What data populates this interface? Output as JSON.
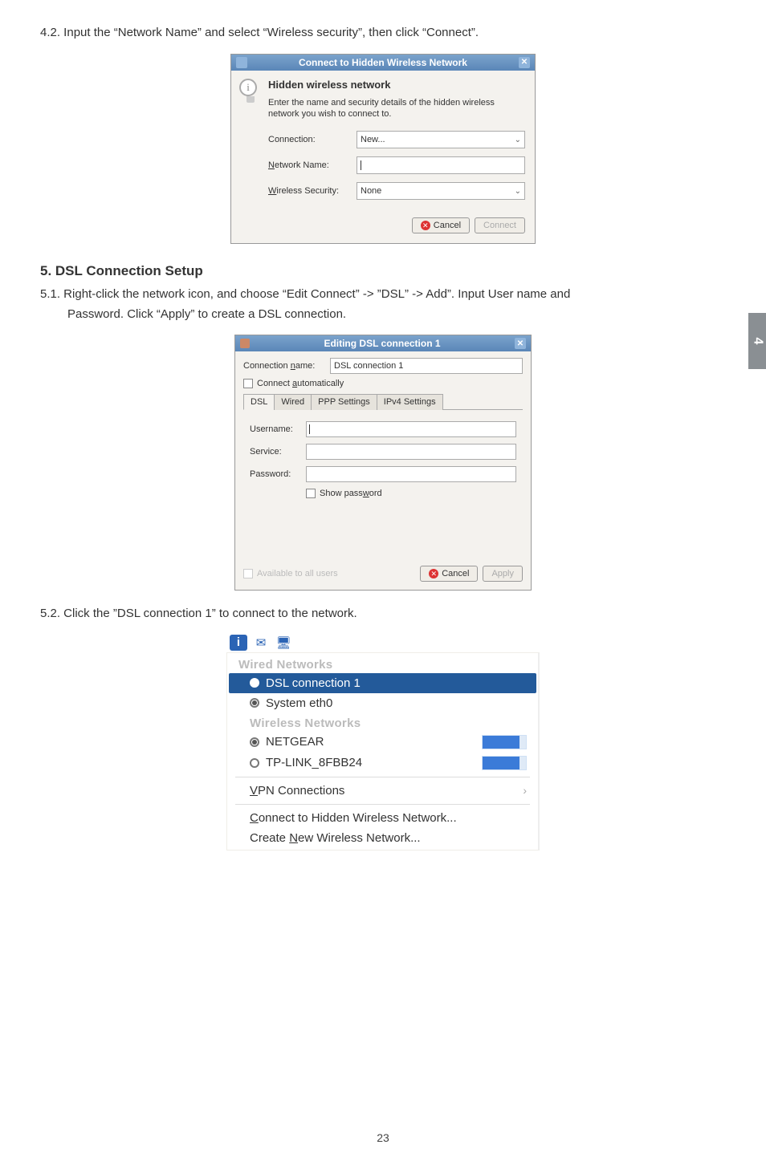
{
  "section42": "4.2. Input the “Network Name” and select “Wireless security”, then click “Connect”.",
  "dialog1": {
    "title": "Connect to Hidden Wireless Network",
    "heading": "Hidden wireless network",
    "desc": "Enter the name and security details of the hidden wireless network you wish to connect to.",
    "connection_label": "Connection:",
    "connection_value": "New...",
    "network_label_pre": "N",
    "network_label_rest": "etwork Name:",
    "security_label_pre": "W",
    "security_label_rest": "ireless Security:",
    "security_value": "None",
    "cancel": "Cancel",
    "connect": "Connect"
  },
  "section5_title": "5. DSL Connection Setup",
  "section51a": "5.1. Right-click the network icon, and choose “Edit Connect” -> ”DSL” -> Add”. Input User name and",
  "section51b": "Password. Click “Apply” to create a DSL connection.",
  "dialog2": {
    "title": "Editing DSL connection 1",
    "connection_name_label_pre": "Connection ",
    "connection_name_underline": "n",
    "connection_name_label_post": "ame:",
    "connection_name_value": "DSL connection 1",
    "auto_underline": "a",
    "auto_label": "utomatically",
    "auto_pre": "Connect ",
    "tabs": [
      "DSL",
      "Wired",
      "PPP Settings",
      "IPv4 Settings"
    ],
    "username_label": "Username:",
    "service_label": "Service:",
    "password_label": "Password:",
    "showpw_pre": "Show pass",
    "showpw_u": "w",
    "showpw_post": "ord",
    "available": "Available to all users",
    "cancel": "Cancel",
    "apply": "Apply"
  },
  "section52": "5.2. Click the ”DSL connection 1” to connect to the network.",
  "menu": {
    "wired_header": "Wired Networks",
    "dsl_item": "DSL connection 1",
    "system_eth": "System eth0",
    "wireless_header": "Wireless Networks",
    "netgear": "NETGEAR",
    "tplink": "TP-LINK_8FBB24",
    "vpn_u": "V",
    "vpn_rest": "PN Connections",
    "connect_hidden_u": "C",
    "connect_hidden_rest": "onnect to Hidden Wireless Network...",
    "create_new_pre": "Create ",
    "create_new_u": "N",
    "create_new_post": "ew Wireless Network..."
  },
  "sidetab": "4",
  "page_number": "23"
}
